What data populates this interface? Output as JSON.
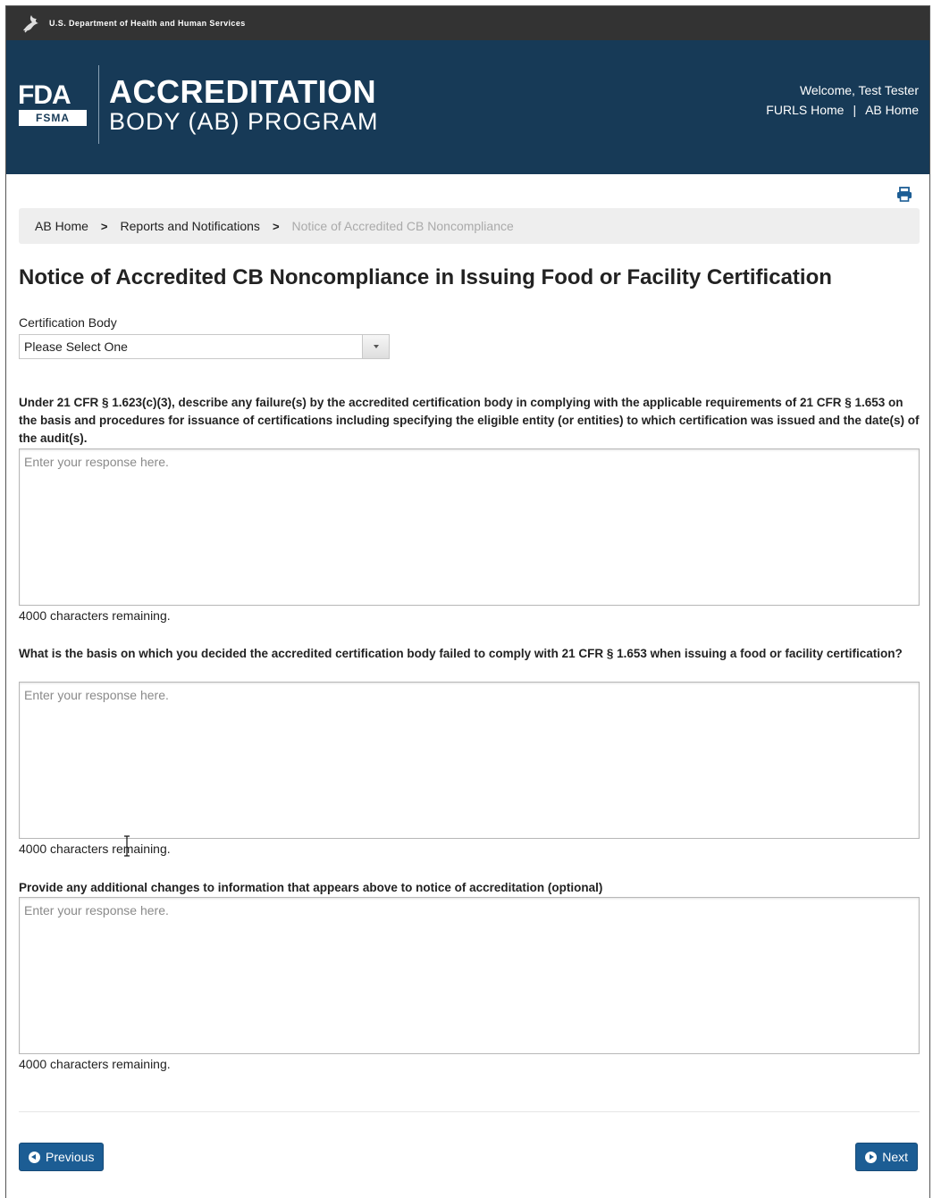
{
  "hhs": {
    "text": "U.S. Department of Health and Human Services"
  },
  "logo": {
    "fda": "FDA",
    "fsma": "FSMA"
  },
  "program": {
    "title": "ACCREDITATION",
    "subtitle": "BODY (AB) PROGRAM"
  },
  "header": {
    "welcome": "Welcome, Test Tester",
    "links": [
      {
        "label": "FURLS Home"
      },
      {
        "label": "AB Home"
      }
    ],
    "separator": "|"
  },
  "breadcrumb": {
    "items": [
      {
        "label": "AB Home"
      },
      {
        "label": "Reports and Notifications"
      },
      {
        "label": "Notice of Accredited CB Noncompliance"
      }
    ],
    "separator": ">"
  },
  "page": {
    "title": "Notice of Accredited CB Noncompliance in Issuing Food or Facility Certification"
  },
  "form": {
    "cert_body_label": "Certification Body",
    "cert_body_value": "Please Select One",
    "q1": "Under 21 CFR § 1.623(c)(3), describe any failure(s) by the accredited certification body in complying with the applicable requirements of 21 CFR § 1.653 on the basis and procedures for issuance of certifications including specifying the eligible entity (or entities) to which certification was issued and the date(s) of the audit(s).",
    "q2": "What is the basis on which you decided the accredited certification body failed to comply with 21 CFR § 1.653 when issuing a food or facility certification?",
    "q3": "Provide any additional changes to information that appears above to notice of accreditation (optional)",
    "placeholder": "Enter your response here.",
    "remaining_1": "4000 characters remaining.",
    "remaining_2": "4000 characters remaining.",
    "remaining_3": "4000 characters remaining."
  },
  "buttons": {
    "previous": "Previous",
    "next": "Next"
  },
  "colors": {
    "banner": "#173a57",
    "topbar": "#333333",
    "button": "#1c5d94",
    "breadcrumb_bg": "#eeeeee"
  },
  "icons": [
    "hhs-eagle-icon",
    "print-icon",
    "chevron-right-icon",
    "caret-down-icon",
    "circle-arrow-left-icon",
    "circle-arrow-right-icon"
  ]
}
